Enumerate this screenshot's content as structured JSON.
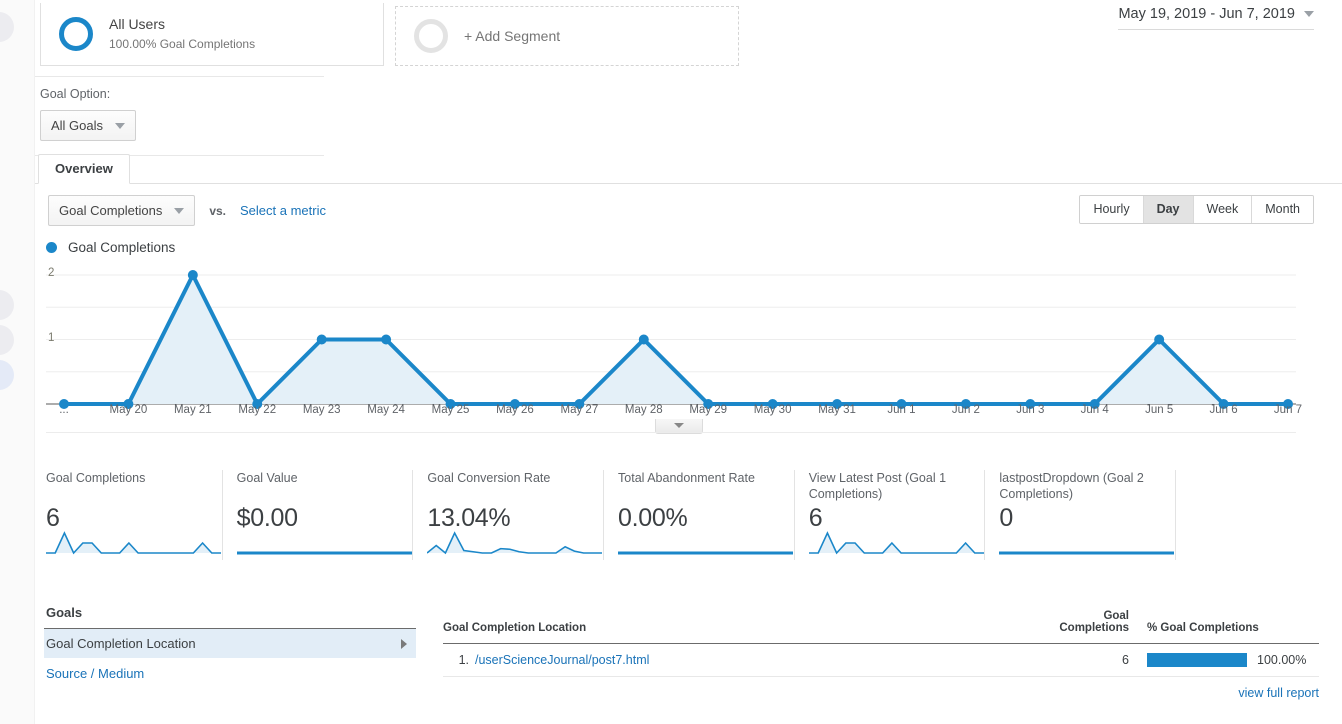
{
  "segments": {
    "primary": {
      "title": "All Users",
      "subtitle": "100.00% Goal Completions"
    },
    "add_label": "+ Add Segment"
  },
  "date_range": {
    "text": "May 19, 2019 - Jun 7, 2019"
  },
  "goal_option": {
    "label": "Goal Option:",
    "selected": "All Goals"
  },
  "tabs": [
    {
      "label": "Overview"
    }
  ],
  "metric_selector": {
    "primary_metric": "Goal Completions",
    "vs_label": "vs.",
    "secondary_metric": "Select a metric"
  },
  "granularity": {
    "options": [
      "Hourly",
      "Day",
      "Week",
      "Month"
    ],
    "selected": "Day"
  },
  "legend": {
    "label": "Goal Completions"
  },
  "chart_data": {
    "type": "line",
    "title": "Goal Completions",
    "xlabel": "",
    "ylabel": "",
    "ylim": [
      0,
      2
    ],
    "yticks": [
      0,
      1,
      2
    ],
    "ytick_labels": [
      "",
      "1",
      "2"
    ],
    "grid": true,
    "legend_position": "top-left",
    "series_color": "#1b87c9",
    "fill_color": "#e4f0f8",
    "categories": [
      "...",
      "May 20",
      "May 21",
      "May 22",
      "May 23",
      "May 24",
      "May 25",
      "May 26",
      "May 27",
      "May 28",
      "May 29",
      "May 30",
      "May 31",
      "Jun 1",
      "Jun 2",
      "Jun 3",
      "Jun 4",
      "Jun 5",
      "Jun 6",
      "Jun 7"
    ],
    "series": [
      {
        "name": "Goal Completions",
        "values": [
          0,
          0,
          2,
          0,
          1,
          1,
          0,
          0,
          0,
          1,
          0,
          0,
          0,
          0,
          0,
          0,
          0,
          1,
          0,
          0
        ]
      }
    ]
  },
  "cards": [
    {
      "title": "Goal Completions",
      "value": "6",
      "spark": [
        0,
        0,
        2,
        0,
        1,
        1,
        0,
        0,
        0,
        1,
        0,
        0,
        0,
        0,
        0,
        0,
        0,
        1,
        0,
        0
      ],
      "spark_filled": true
    },
    {
      "title": "Goal Value",
      "value": "$0.00",
      "spark": [
        0,
        0,
        0,
        0,
        0,
        0,
        0,
        0,
        0,
        0,
        0,
        0,
        0,
        0,
        0,
        0,
        0,
        0,
        0,
        0
      ],
      "spark_filled": false
    },
    {
      "title": "Goal Conversion Rate",
      "value": "13.04%",
      "spark": [
        0,
        0.6,
        0,
        1.6,
        0.2,
        0.1,
        0,
        0,
        0.35,
        0.3,
        0.1,
        0,
        0,
        0,
        0,
        0.5,
        0.15,
        0,
        0,
        0
      ],
      "spark_filled": true
    },
    {
      "title": "Total Abandonment Rate",
      "value": "0.00%",
      "spark": [
        0,
        0,
        0,
        0,
        0,
        0,
        0,
        0,
        0,
        0,
        0,
        0,
        0,
        0,
        0,
        0,
        0,
        0,
        0,
        0
      ],
      "spark_filled": false
    },
    {
      "title": "View Latest Post (Goal 1 Completions)",
      "value": "6",
      "spark": [
        0,
        0,
        2,
        0,
        1,
        1,
        0,
        0,
        0,
        1,
        0,
        0,
        0,
        0,
        0,
        0,
        0,
        1,
        0,
        0
      ],
      "spark_filled": true
    },
    {
      "title": "lastpostDropdown (Goal 2 Completions)",
      "value": "0",
      "spark": [
        0,
        0,
        0,
        0,
        0,
        0,
        0,
        0,
        0,
        0,
        0,
        0,
        0,
        0,
        0,
        0,
        0,
        0,
        0,
        0
      ],
      "spark_filled": false
    }
  ],
  "goals_panel": {
    "header": "Goals",
    "items": [
      {
        "label": "Goal Completion Location",
        "selected": true
      }
    ],
    "link": "Source / Medium"
  },
  "table": {
    "columns": [
      "Goal Completion Location",
      "Goal Completions",
      "% Goal Completions"
    ],
    "rows": [
      {
        "index": "1.",
        "location": "/userScienceJournal/post7.html",
        "completions": "6",
        "percent": "100.00%",
        "bar_pct": 100
      }
    ],
    "footer_link": "view full report"
  },
  "colors": {
    "accent": "#1b87c9",
    "link": "#1a73b8",
    "fill": "#e4f0f8"
  }
}
